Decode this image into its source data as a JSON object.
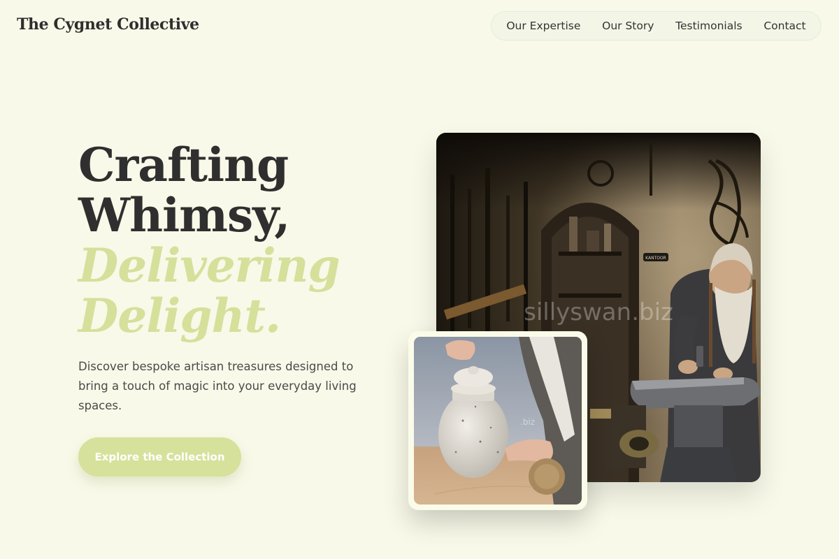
{
  "brand": {
    "name": "The Cygnet Collective"
  },
  "nav": {
    "items": [
      {
        "label": "Our Expertise"
      },
      {
        "label": "Our Story"
      },
      {
        "label": "Testimonials"
      },
      {
        "label": "Contact"
      }
    ]
  },
  "hero": {
    "title_line1": "Crafting",
    "title_line2": "Whimsy,",
    "title_accent1": "Delivering",
    "title_accent2": "Delight.",
    "subtitle": "Discover bespoke artisan treasures designed to bring a touch of magic into your everyday living spaces.",
    "cta_label": "Explore the Collection"
  },
  "images": {
    "main_watermark": "sillyswan.biz",
    "small_watermark": ".biz",
    "shop_sign": "KANTOOR"
  },
  "colors": {
    "background": "#f8f9e8",
    "accent": "#d6e19b",
    "text_dark": "#2f2f2f"
  }
}
